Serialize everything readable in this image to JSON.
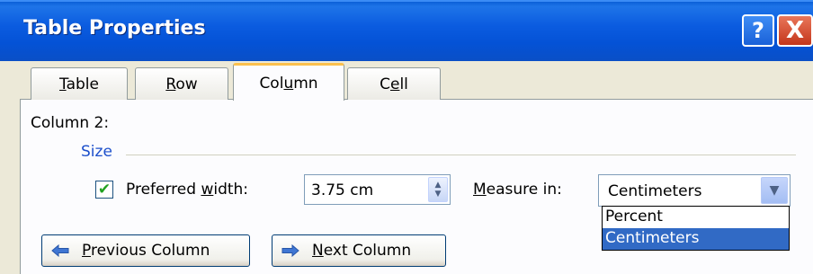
{
  "window": {
    "title": "Table Properties",
    "help_glyph": "?",
    "close_glyph": "X"
  },
  "tabs": [
    {
      "label": "Table",
      "mnemonic": "T",
      "rest": "able",
      "active": false
    },
    {
      "label": "Row",
      "mnemonic": "R",
      "rest": "ow",
      "active": false
    },
    {
      "label": "Column",
      "pre": "Col",
      "mnemonic": "u",
      "rest": "mn",
      "active": true
    },
    {
      "label": "Cell",
      "pre": "C",
      "mnemonic": "e",
      "rest": "ll",
      "active": false
    }
  ],
  "panel": {
    "column_label": "Column 2:",
    "group_label": "Size",
    "preferred_width": {
      "checked": true,
      "label_pre": "Preferred ",
      "label_mnemonic": "w",
      "label_rest": "idth:",
      "value": "3.75 cm"
    },
    "measure_in": {
      "label_mnemonic": "M",
      "label_rest": "easure in:",
      "selected": "Centimeters",
      "options": [
        "Percent",
        "Centimeters"
      ],
      "highlighted_index": 1
    }
  },
  "buttons": {
    "previous": {
      "mnemonic": "P",
      "rest": "revious Column"
    },
    "next": {
      "mnemonic": "N",
      "rest": "ext Column"
    }
  },
  "colors": {
    "titlebar": "#0452d6",
    "accent_text": "#1c4fcb",
    "highlight": "#316ac5",
    "active_tab_top": "#fbc04d"
  },
  "icons": {
    "check": "checkmark-icon",
    "spinner": "up-down-spinner-icon",
    "dropdown": "chevron-down-icon",
    "prev": "arrow-left-icon",
    "next": "arrow-right-icon"
  }
}
